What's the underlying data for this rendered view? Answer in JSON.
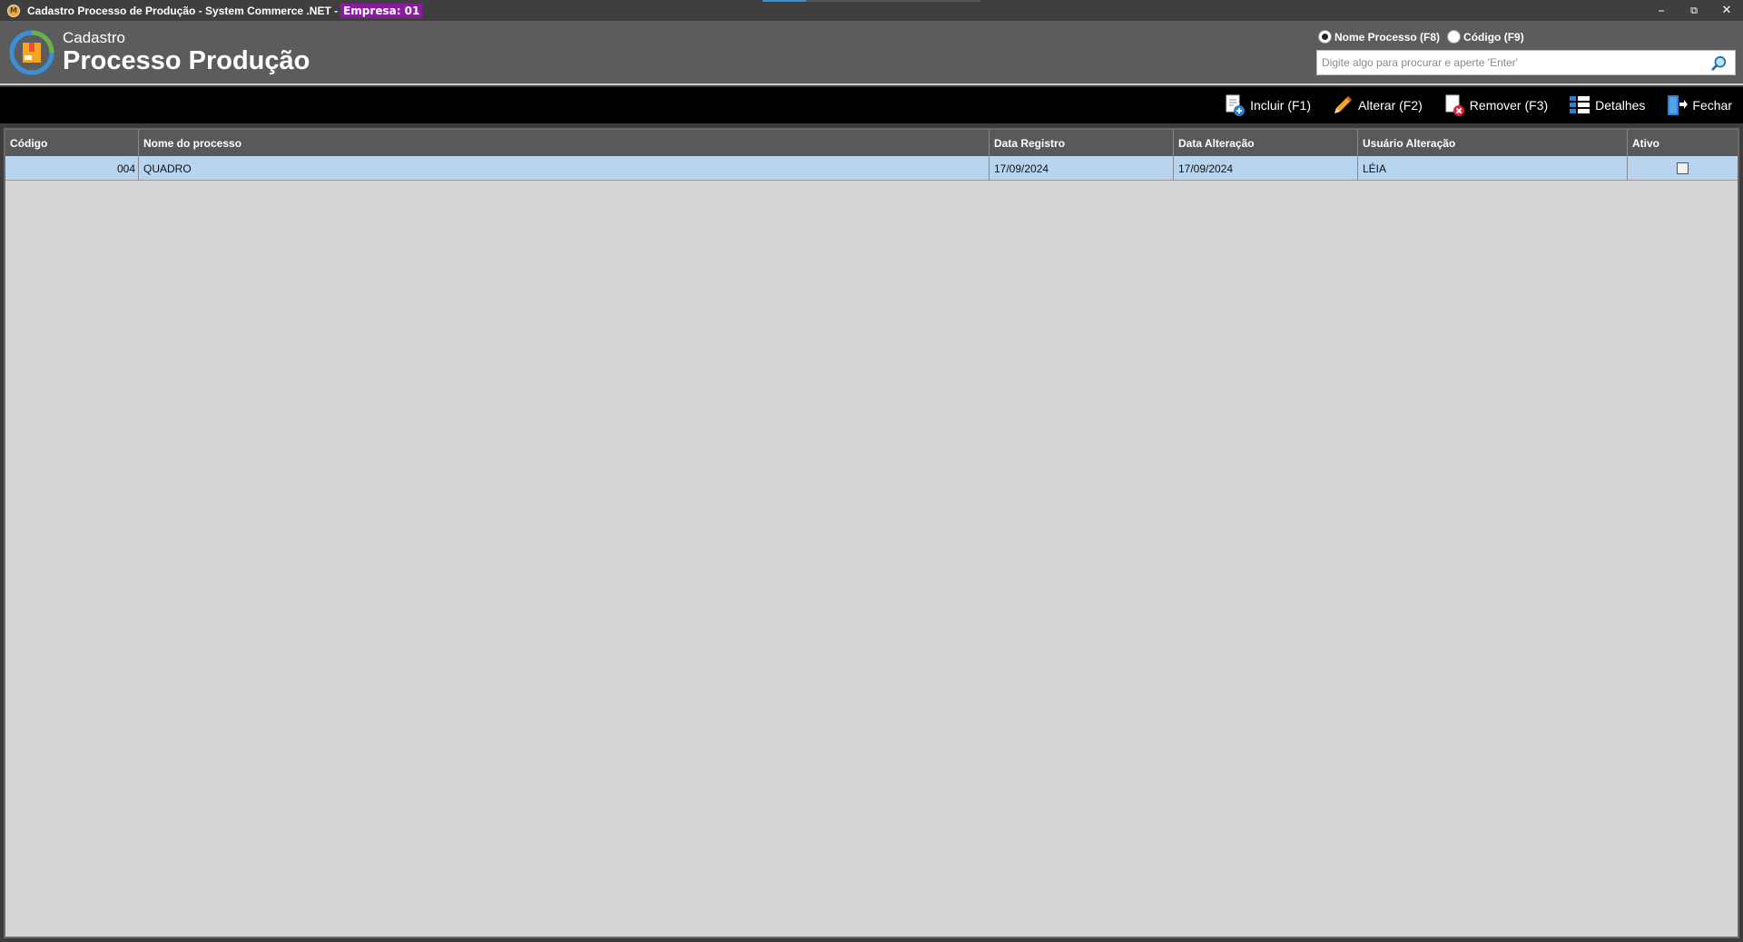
{
  "window": {
    "title": "Cadastro Processo de Produção - System Commerce .NET - ",
    "empresa": "Empresa: 01",
    "minimize": "–",
    "restore": "⧉",
    "close": "✕"
  },
  "header": {
    "subtitle": "Cadastro",
    "title": "Processo Produção"
  },
  "search": {
    "options": [
      {
        "label": "Nome Processo (F8)",
        "checked": true
      },
      {
        "label": "Código (F9)",
        "checked": false
      }
    ],
    "placeholder": "Digite algo para procurar e aperte 'Enter'",
    "value": ""
  },
  "toolbar": {
    "incluir": "Incluir (F1)",
    "alterar": "Alterar (F2)",
    "remover": "Remover (F3)",
    "detalhes": "Detalhes",
    "fechar": "Fechar"
  },
  "grid": {
    "columns": [
      "Código",
      "Nome do processo",
      "Data Registro",
      "Data Alteração",
      "Usuário Alteração",
      "Ativo"
    ],
    "rows": [
      {
        "codigo": "004",
        "nome": "QUADRO",
        "data_registro": "17/09/2024",
        "data_alteracao": "17/09/2024",
        "usuario": "LÉIA",
        "ativo": false
      }
    ]
  },
  "colors": {
    "accent_purple": "#8a1ba0",
    "selected_row": "#b9d4ee",
    "header_bg": "#5c5c5c",
    "toolbar_bg": "#000000"
  }
}
